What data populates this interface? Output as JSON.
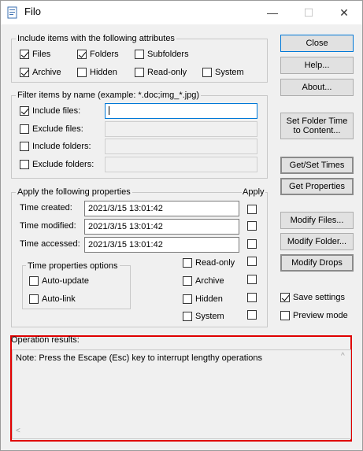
{
  "window": {
    "title": "Filo",
    "minimize": "—",
    "maximize": "☐",
    "close": "✕"
  },
  "attributes": {
    "title": "Include items with the following attributes",
    "files": "Files",
    "folders": "Folders",
    "subfolders": "Subfolders",
    "archive": "Archive",
    "hidden": "Hidden",
    "readonly": "Read-only",
    "system": "System"
  },
  "filter": {
    "title": "Filter items by name (example: *.doc;img_*.jpg)",
    "include_files": "Include files:",
    "exclude_files": "Exclude files:",
    "include_folders": "Include folders:",
    "exclude_folders": "Exclude folders:"
  },
  "properties": {
    "title": "Apply the following properties",
    "apply": "Apply",
    "time_created": "Time created:",
    "time_modified": "Time modified:",
    "time_accessed": "Time accessed:",
    "created_value": "2021/3/15 13:01:42",
    "modified_value": "2021/3/15 13:01:42",
    "accessed_value": "2021/3/15 13:01:42",
    "options_title": "Time properties options",
    "auto_update": "Auto-update",
    "auto_link": "Auto-link",
    "readonly": "Read-only",
    "archive": "Archive",
    "hidden": "Hidden",
    "system": "System"
  },
  "buttons": {
    "close": "Close",
    "help": "Help...",
    "about": "About...",
    "set_folder_time": "Set Folder Time to Content...",
    "get_set_times": "Get/Set Times",
    "get_properties": "Get Properties",
    "modify_files": "Modify Files...",
    "modify_folder": "Modify Folder...",
    "modify_drops": "Modify Drops"
  },
  "options": {
    "save_settings": "Save settings",
    "preview_mode": "Preview mode"
  },
  "results": {
    "label": "Operation results:",
    "text": "Note: Press the Escape (Esc) key to interrupt lengthy operations",
    "scroll_up": "^",
    "scroll_left": "<"
  }
}
